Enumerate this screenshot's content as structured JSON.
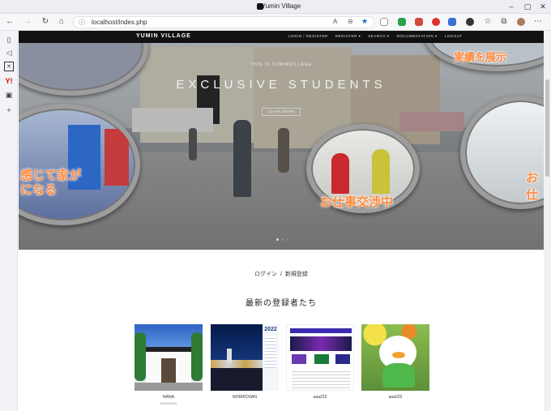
{
  "browser": {
    "window_title": "Yumin Village",
    "address_url": "localhost/index.php"
  },
  "site": {
    "brand": "YUMIN VILLAGE",
    "nav": [
      "LOGIN / REGISTER",
      "REGISTER ▾",
      "SEARCH ▾",
      "DOCUMENTATION ▾",
      "LOGOUT"
    ],
    "hero": {
      "small_text": "THIS IS YUMINVILLAGE",
      "big_text": "EXCLUSIVE STUDENTS",
      "button": "LEARN MORE",
      "bubble_texts": {
        "top_right": "実績を展示",
        "left": "感じて家が\nになる",
        "center": "お仕事交渉中",
        "right": "お仕"
      }
    },
    "auth_links": {
      "login": "ログイン",
      "separator": "/",
      "register": "新規登録"
    },
    "section_title": "最新の登録者たち",
    "cards": [
      {
        "name": "NANA",
        "sub": "2020/00/00"
      },
      {
        "name": "NORIKOSAN",
        "sub": ""
      },
      {
        "name": "aaa222",
        "sub": ""
      },
      {
        "name": "aaa222",
        "sub": ""
      }
    ],
    "poster_year": "2022"
  }
}
